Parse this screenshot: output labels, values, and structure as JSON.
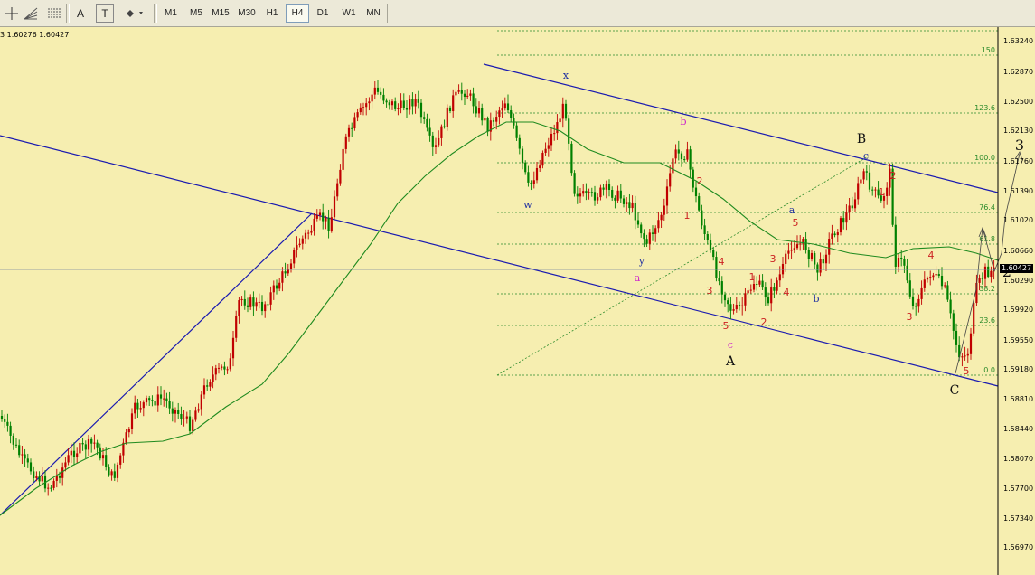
{
  "toolbar": {
    "tools": [
      {
        "name": "crosshair-tool-icon",
        "glyph": "┼"
      },
      {
        "name": "fibonacci-fan-icon",
        "glyph": "▦"
      },
      {
        "name": "fibonacci-grid-icon",
        "glyph": "▤"
      },
      {
        "name": "text-tool-icon",
        "glyph": "A"
      },
      {
        "name": "text-label-icon",
        "glyph": "T"
      },
      {
        "name": "arrows-tool-icon",
        "glyph": "⬘▾"
      }
    ],
    "timeframes": [
      "M1",
      "M5",
      "M15",
      "M30",
      "H1",
      "H4",
      "D1",
      "W1",
      "MN"
    ],
    "active_timeframe": "H4"
  },
  "chart": {
    "price_header": "3 1.60276 1.60427",
    "current_price": "1.60427",
    "price_axis_labels": [
      "1.63240",
      "1.62870",
      "1.62500",
      "1.62130",
      "1.61760",
      "1.61390",
      "1.61020",
      "1.60660",
      "1.60290",
      "1.59920",
      "1.59550",
      "1.59180",
      "1.58810",
      "1.58440",
      "1.58070",
      "1.57700",
      "1.57340",
      "1.56970"
    ],
    "fib_levels": [
      "150",
      "123.6",
      "100.0",
      "76.4",
      "61.8",
      "38.2",
      "23.6",
      "0.0"
    ],
    "wave_labels": {
      "blue": [
        "x",
        "w",
        "y",
        "a",
        "b",
        "c"
      ],
      "magenta": [
        "b",
        "a",
        "c"
      ],
      "black": [
        "A",
        "B",
        "C",
        "2",
        "3"
      ],
      "red_main": [
        "1",
        "2",
        "3",
        "4",
        "5"
      ],
      "red_sub": [
        "1",
        "2",
        "3",
        "4",
        "5"
      ],
      "red_later": [
        "1",
        "2",
        "3",
        "4",
        "5"
      ]
    },
    "colors": {
      "background": "#f6eeb0",
      "bull_candle": "#c00000",
      "bear_candle": "#008000",
      "moving_average": "#1f8a1f",
      "channel_lines": "#1a1ab0",
      "fib_lines": "#2a8a2a",
      "wave_red": "#cc2222",
      "wave_blue": "#2030a0",
      "wave_magenta": "#cc22cc"
    }
  }
}
